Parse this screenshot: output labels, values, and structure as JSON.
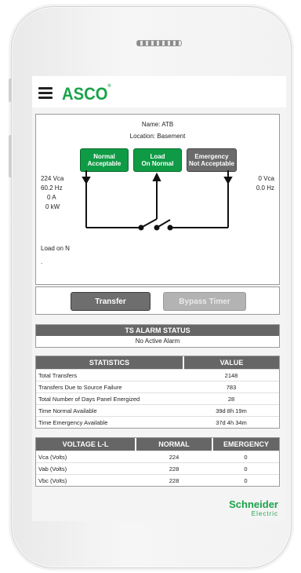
{
  "app": {
    "brand": "ASCO",
    "brand_mark": "®"
  },
  "diagram": {
    "name": "Name: ATB",
    "location": "Location: Basement",
    "buttons": [
      {
        "line1": "Normal",
        "line2": "Acceptable",
        "color": "#0f9b45"
      },
      {
        "line1": "Load",
        "line2": "On Normal",
        "color": "#0f9b45"
      },
      {
        "line1": "Emergency",
        "line2": "Not Acceptable",
        "color": "#6b6b6b"
      }
    ],
    "normal": {
      "voltage": "224 Vca",
      "freq": "60.2 Hz",
      "amps": "0 A",
      "kw": "0 kW"
    },
    "emergency": {
      "voltage": "0 Vca",
      "freq": "0.0 Hz"
    },
    "load_text": "Load on N",
    "dot": "."
  },
  "controls": {
    "transfer": "Transfer",
    "bypass": "Bypass Timer"
  },
  "alarm": {
    "title": "TS ALARM STATUS",
    "status": "No Active Alarm"
  },
  "statistics": {
    "headers": [
      "STATISTICS",
      "VALUE"
    ],
    "rows": [
      [
        "Total Transfers",
        "2148"
      ],
      [
        "Transfers Due to Source Failure",
        "783"
      ],
      [
        "Total Number of Days Panel Energized",
        "28"
      ],
      [
        "Time Normal Available",
        "39d 8h 19m"
      ],
      [
        "Time Emergency Available",
        "37d 4h 34m"
      ]
    ]
  },
  "voltage": {
    "headers": [
      "VOLTAGE L-L",
      "NORMAL",
      "EMERGENCY"
    ],
    "rows": [
      [
        "Vca (Volts)",
        "224",
        "0"
      ],
      [
        "Vab (Volts)",
        "228",
        "0"
      ],
      [
        "Vbc (Volts)",
        "228",
        "0"
      ]
    ]
  },
  "footer": {
    "brand_line1": "Schneider",
    "brand_line2": "Electric"
  },
  "colors": {
    "accent": "#1aa34a",
    "header_grey": "#666666"
  }
}
